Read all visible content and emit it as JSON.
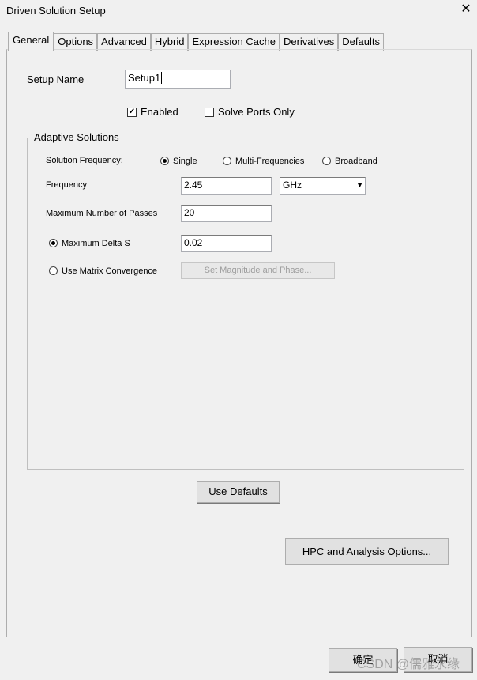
{
  "window": {
    "title": "Driven Solution Setup"
  },
  "tabs": [
    "General",
    "Options",
    "Advanced",
    "Hybrid",
    "Expression Cache",
    "Derivatives",
    "Defaults"
  ],
  "general": {
    "setup_name_label": "Setup Name",
    "setup_name_value": "Setup1",
    "enabled_label": "Enabled",
    "enabled_checked": true,
    "solve_ports_label": "Solve Ports Only",
    "solve_ports_checked": false
  },
  "adaptive": {
    "title": "Adaptive Solutions",
    "solution_frequency_label": "Solution Frequency:",
    "freq_options": [
      "Single",
      "Multi-Frequencies",
      "Broadband"
    ],
    "freq_selected": "Single",
    "frequency_label": "Frequency",
    "frequency_value": "2.45",
    "frequency_unit": "GHz",
    "max_passes_label": "Maximum Number of Passes",
    "max_passes_value": "20",
    "max_delta_label": "Maximum Delta S",
    "max_delta_value": "0.02",
    "matrix_label": "Use Matrix Convergence",
    "set_mag_button": "Set Magnitude and Phase..."
  },
  "buttons": {
    "use_defaults": "Use Defaults",
    "hpc": "HPC and Analysis Options...",
    "ok": "确定",
    "cancel": "取消"
  },
  "watermark": "CSDN @儒雅永缘"
}
